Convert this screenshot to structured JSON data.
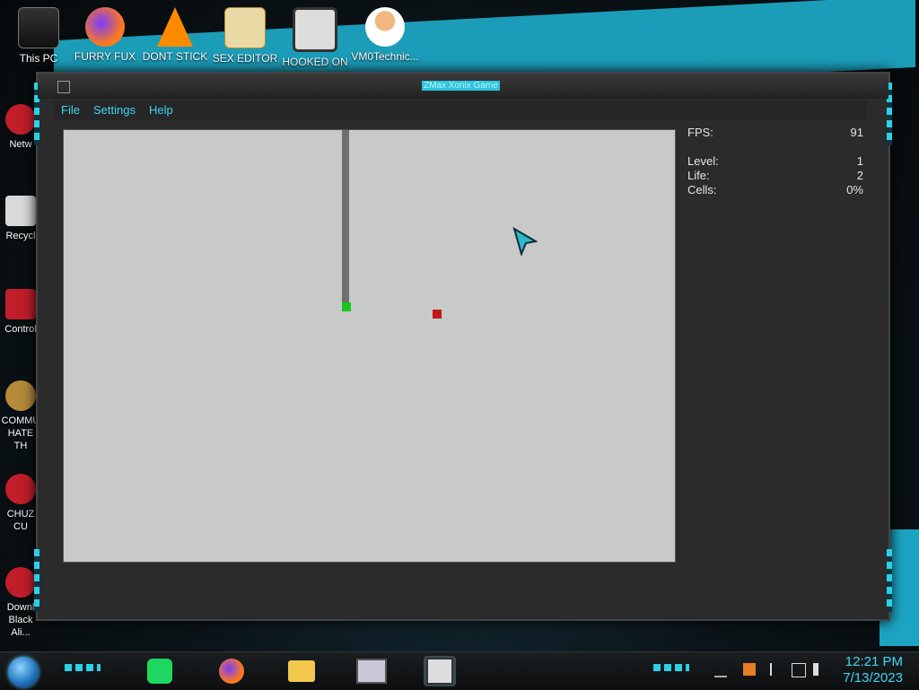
{
  "desktop_icons_top": [
    {
      "label": "This PC",
      "icon": "this-pc-icon"
    },
    {
      "label": "FURRY FUX",
      "icon": "firefox-icon"
    },
    {
      "label": "DONT STICK",
      "icon": "vlc-icon"
    },
    {
      "label": "SEX EDITOR",
      "icon": "hxd-icon"
    },
    {
      "label": "HOOKED ON XONIX",
      "icon": "xonix-icon"
    },
    {
      "label": "VM0Technic...",
      "icon": "doctor-icon"
    }
  ],
  "desktop_icons_left": [
    {
      "label": "Netw",
      "icon": "network-icon"
    },
    {
      "label": "Recycl",
      "icon": "recycle-bin-icon"
    },
    {
      "label": "Control",
      "icon": "control-panel-icon"
    },
    {
      "label": "COMMU HATE TH",
      "icon": "money-bag-icon"
    },
    {
      "label": "CHUZ CU",
      "icon": "red-character-icon"
    },
    {
      "label": "Downl Black Ali...",
      "icon": "download-icon"
    }
  ],
  "window": {
    "title": "ZMax Xonix Game",
    "menu": [
      "File",
      "Settings",
      "Help"
    ]
  },
  "stats": {
    "fps_label": "FPS:",
    "fps": "91",
    "level_label": "Level:",
    "level": "1",
    "life_label": "Life:",
    "life": "2",
    "cells_label": "Cells:",
    "cells": "0%"
  },
  "game": {
    "player_color": "#18c51c",
    "enemy_color": "#c1161b",
    "trail_color": "#6f6f6f",
    "field_color": "#c8c9c9"
  },
  "taskbar": {
    "pinned": [
      "spotify-icon",
      "firefox-icon",
      "file-explorer-icon",
      "monitor-icon",
      "xonix-icon"
    ],
    "clock_time": "12:21 PM",
    "clock_date": "7/13/2023",
    "accent": "#3fd7f0"
  }
}
